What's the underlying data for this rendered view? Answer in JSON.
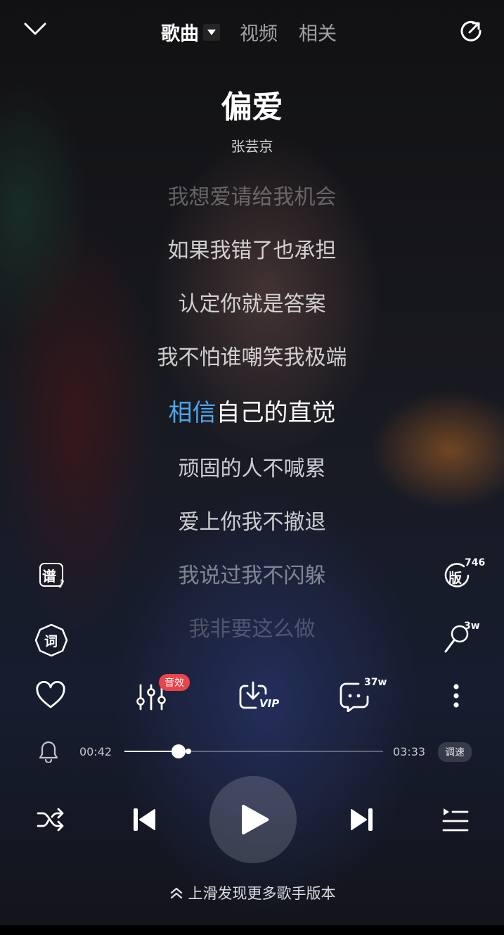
{
  "tabs": [
    {
      "label": "歌曲",
      "active": true
    },
    {
      "label": "视频",
      "active": false
    },
    {
      "label": "相关",
      "active": false
    }
  ],
  "song": {
    "title": "偏爱",
    "artist": "张芸京"
  },
  "lyrics": {
    "l1": "我想爱请给我机会",
    "l2": "如果我错了也承担",
    "l3": "认定你就是答案",
    "l4": "我不怕谁嘲笑我极端",
    "current_sung": "相信",
    "current_rest": "自己的直觉",
    "l6": "顽固的人不喊累",
    "l7": "爱上你我不撤退",
    "l8": "我说过我不闪躲",
    "l9": "我非要这么做"
  },
  "side": {
    "score_label": "谱",
    "lyric_label": "词",
    "version_label": "版",
    "version_count": "746",
    "singalong_count": "3w"
  },
  "actions": {
    "sound_effect_badge": "音效",
    "download_vip": "VIP",
    "comment_count": "37w"
  },
  "progress": {
    "elapsed": "00:42",
    "total": "03:33",
    "fraction": 0.21,
    "speed_label": "调速"
  },
  "footer": {
    "swipe_hint": "上滑发现更多歌手版本"
  },
  "colors": {
    "accent_blue": "#4ba8ef",
    "badge_red": "#e8454a"
  }
}
